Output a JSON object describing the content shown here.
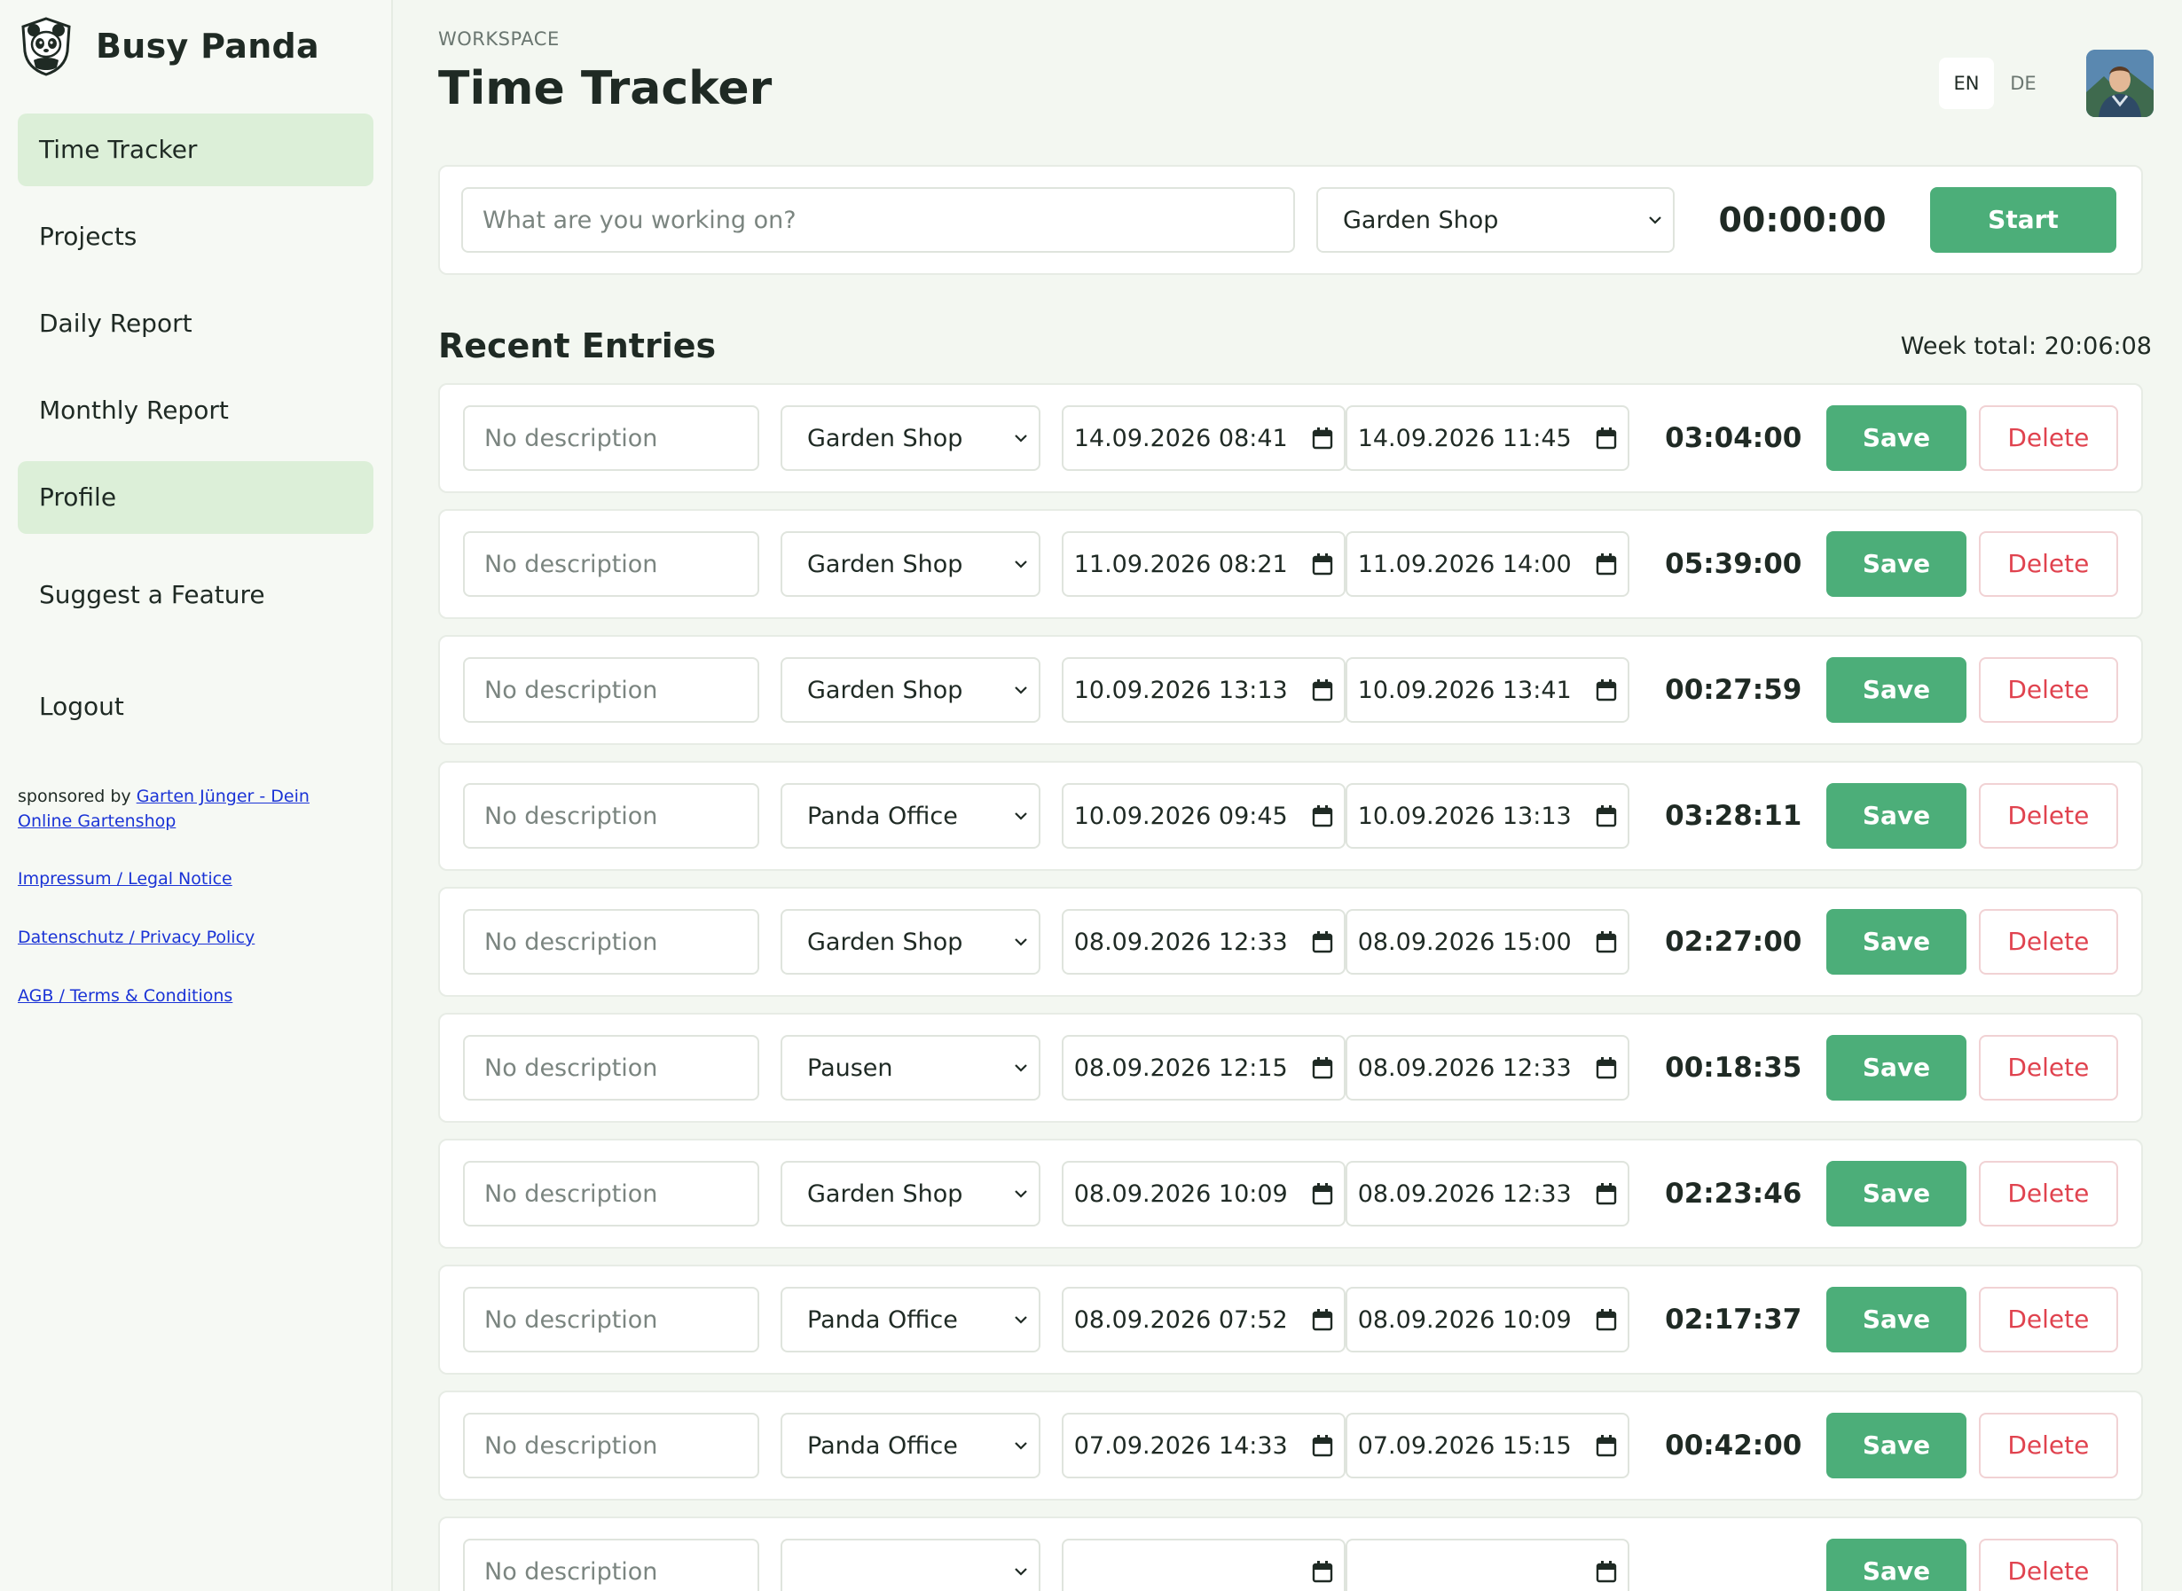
{
  "brand": {
    "name": "Busy Panda",
    "logo_icon": "panda-logo-icon"
  },
  "sidebar": {
    "items": [
      {
        "label": "Time Tracker",
        "active": true
      },
      {
        "label": "Projects",
        "active": false
      },
      {
        "label": "Daily Report",
        "active": false
      },
      {
        "label": "Monthly Report",
        "active": false
      },
      {
        "label": "Profile",
        "active": true
      }
    ],
    "suggest": "Suggest a Feature",
    "logout": "Logout",
    "sponsor_prefix": "sponsored by ",
    "sponsor_link": "Garten Jünger - Dein Online Gartenshop",
    "legal_links": [
      "Impressum / Legal Notice",
      "Datenschutz / Privacy Policy",
      "AGB / Terms & Conditions"
    ]
  },
  "header": {
    "overline": "WORKSPACE",
    "title": "Time Tracker",
    "languages": [
      "EN",
      "DE"
    ],
    "active_language": "EN"
  },
  "timer": {
    "placeholder": "What are you working on?",
    "project": "Garden Shop",
    "elapsed": "00:00:00",
    "start_label": "Start"
  },
  "recent": {
    "title": "Recent Entries",
    "week_total": "Week total: 20:06:08"
  },
  "entry_labels": {
    "desc_placeholder": "No description",
    "save": "Save",
    "delete": "Delete"
  },
  "entries": [
    {
      "project": "Garden Shop",
      "start": "14.09.2026 08:41",
      "end": "14.09.2026 11:45",
      "duration": "03:04:00"
    },
    {
      "project": "Garden Shop",
      "start": "11.09.2026 08:21",
      "end": "11.09.2026 14:00",
      "duration": "05:39:00"
    },
    {
      "project": "Garden Shop",
      "start": "10.09.2026 13:13",
      "end": "10.09.2026 13:41",
      "duration": "00:27:59"
    },
    {
      "project": "Panda Office",
      "start": "10.09.2026 09:45",
      "end": "10.09.2026 13:13",
      "duration": "03:28:11"
    },
    {
      "project": "Garden Shop",
      "start": "08.09.2026 12:33",
      "end": "08.09.2026 15:00",
      "duration": "02:27:00"
    },
    {
      "project": "Pausen",
      "start": "08.09.2026 12:15",
      "end": "08.09.2026 12:33",
      "duration": "00:18:35"
    },
    {
      "project": "Garden Shop",
      "start": "08.09.2026 10:09",
      "end": "08.09.2026 12:33",
      "duration": "02:23:46"
    },
    {
      "project": "Panda Office",
      "start": "08.09.2026 07:52",
      "end": "08.09.2026 10:09",
      "duration": "02:17:37"
    },
    {
      "project": "Panda Office",
      "start": "07.09.2026 14:33",
      "end": "07.09.2026 15:15",
      "duration": "00:42:00"
    },
    {
      "project": "",
      "start": "",
      "end": "",
      "duration": ""
    }
  ],
  "colors": {
    "accent": "#4cae79",
    "nav_active": "#dcefd8",
    "danger": "#e0434f",
    "background": "#f3f7f1"
  }
}
